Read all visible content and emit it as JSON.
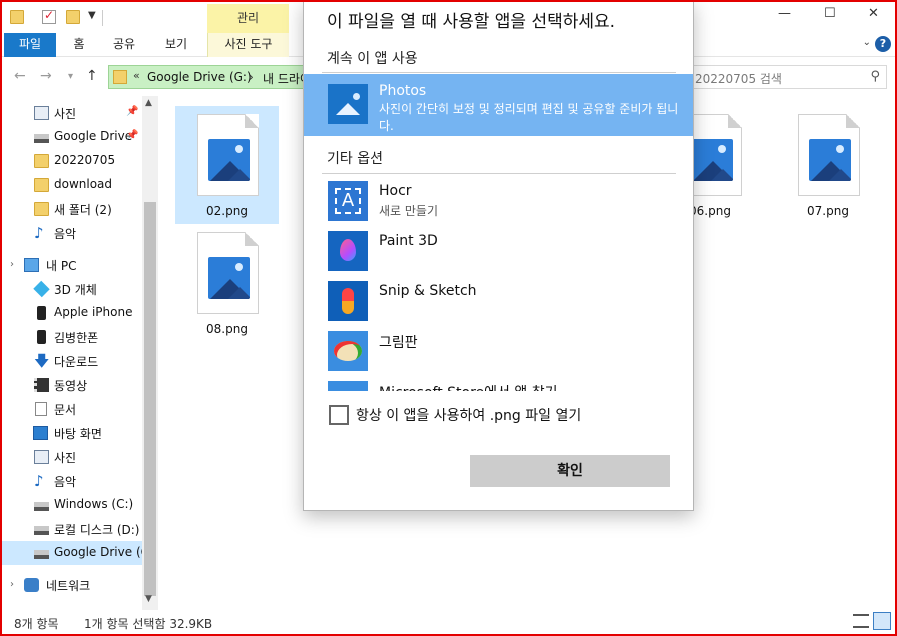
{
  "window": {
    "context_header": "관리",
    "controls": {
      "minimize": "—",
      "maximize": "☐",
      "close": "✕"
    }
  },
  "ribbon": {
    "tabs": [
      "파일",
      "홈",
      "공유",
      "보기",
      "사진 도구"
    ]
  },
  "address": {
    "prefix": "«",
    "part1": "Google Drive (G:)",
    "separator": "›",
    "part2": "내 드라이브",
    "search_placeholder": "20220705 검색"
  },
  "navpane": {
    "quick_access": [
      {
        "label": "사진",
        "icon": "pictures-icon",
        "pinned": true
      },
      {
        "label": "Google Drive",
        "icon": "drive-icon",
        "pinned": true
      },
      {
        "label": "20220705",
        "icon": "folder-icon"
      },
      {
        "label": "download",
        "icon": "folder-icon"
      },
      {
        "label": "새 폴더 (2)",
        "icon": "folder-icon"
      },
      {
        "label": "음악",
        "icon": "music-icon"
      }
    ],
    "this_pc": {
      "label": "내 PC",
      "icon": "pc-icon"
    },
    "pc_items": [
      {
        "label": "3D 개체",
        "icon": "3d-objects-icon"
      },
      {
        "label": "Apple iPhone",
        "icon": "phone-icon"
      },
      {
        "label": "김병한폰",
        "icon": "phone-icon"
      },
      {
        "label": "다운로드",
        "icon": "downloads-icon"
      },
      {
        "label": "동영상",
        "icon": "videos-icon"
      },
      {
        "label": "문서",
        "icon": "documents-icon"
      },
      {
        "label": "바탕 화면",
        "icon": "desktop-icon"
      },
      {
        "label": "사진",
        "icon": "pictures-icon"
      },
      {
        "label": "음악",
        "icon": "music-icon"
      },
      {
        "label": "Windows (C:)",
        "icon": "drive-icon"
      },
      {
        "label": "로컬 디스크 (D:)",
        "icon": "drive-icon"
      },
      {
        "label": "Google Drive (G:)",
        "icon": "drive-icon",
        "selected": true
      }
    ],
    "network": {
      "label": "네트워크",
      "icon": "network-icon"
    }
  },
  "files": [
    {
      "name": "02.png",
      "selected": true
    },
    {
      "name": "06.png"
    },
    {
      "name": "07.png"
    },
    {
      "name": "08.png"
    }
  ],
  "status": {
    "count": "8개 항목",
    "selection": "1개 항목 선택함 32.9KB"
  },
  "dialog": {
    "title": "이 파일을 열 때 사용할 앱을 선택하세요.",
    "keep_using": "계속 이 앱 사용",
    "selected_app": {
      "name": "Photos",
      "description": "사진이 간단히 보정 및 정리되며 편집 및 공유할 준비가 됩니다."
    },
    "other_options": "기타 옵션",
    "apps": [
      {
        "name": "Hocr",
        "subtitle": "새로 만들기",
        "icon": "hocr-icon"
      },
      {
        "name": "Paint 3D",
        "subtitle": "",
        "icon": "paint-3d-icon"
      },
      {
        "name": "Snip & Sketch",
        "subtitle": "",
        "icon": "snip-sketch-icon"
      },
      {
        "name": "그림판",
        "subtitle": "",
        "icon": "mspaint-icon"
      },
      {
        "name": "Microsoft Store에서 앱 찾기",
        "subtitle": "",
        "icon": "store-icon"
      }
    ],
    "always_use_label": "항상 이 앱을 사용하여 .png 파일 열기",
    "always_use_checked": false,
    "ok_label": "확인"
  },
  "colors": {
    "file_tab": "#1979ca",
    "context_tab": "#fbf3a7",
    "address_bar": "#c9f0c4",
    "selection": "#cce8ff",
    "selected_app_bg": "#75b4f2",
    "frame_border": "#e30000"
  }
}
